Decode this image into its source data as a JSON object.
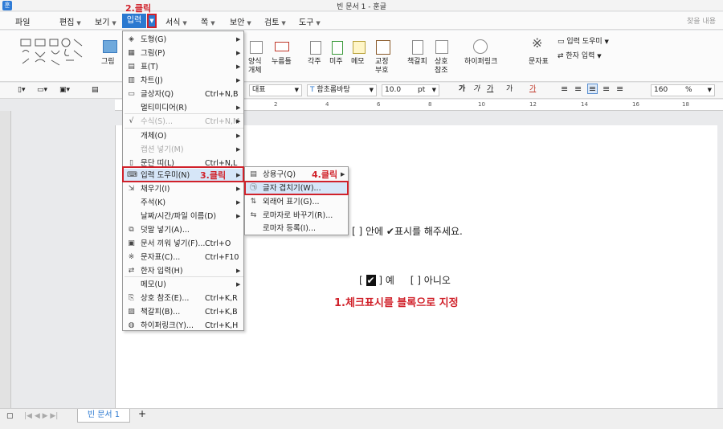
{
  "window": {
    "app_icon": "훈",
    "title": "빈 문서 1 - 훈글"
  },
  "menubar": {
    "items": [
      "파일",
      "편집",
      "보기",
      "입력",
      "서식",
      "쪽",
      "보안",
      "검토",
      "도구"
    ],
    "search_placeholder": "찾을 내용"
  },
  "ribbon": {
    "picture_label": "그림",
    "style_label": "양식\n개체",
    "button_label": "누름틀",
    "footnote_label": "각주",
    "endnote_label": "미주",
    "memo_label": "메모",
    "proof_label": "교정\n부호",
    "bookmark_label": "책갈피",
    "crossref_label": "상호\n참조",
    "hyperlink_label": "하이퍼링크",
    "charmap_label": "문자표",
    "input_helper_label": "입력 도우미",
    "hanja_label": "한자 입력"
  },
  "format": {
    "style": "대표",
    "font": "함초롬바탕",
    "size": "10.0",
    "size_unit": "pt",
    "zoom": "160",
    "zoom_unit": "%",
    "bold": "가",
    "italic": "가",
    "underline": "가",
    "strike": "가",
    "color": "가"
  },
  "ruler": {
    "ticks": [
      "2",
      "4",
      "6",
      "8",
      "10",
      "12",
      "14",
      "16",
      "18"
    ]
  },
  "document": {
    "line1": "[   ] 안에 ✔표시를 해주세요.",
    "line2_open": "[",
    "line2_check": "✔",
    "line2_close": "] 예",
    "line2_rest": "[    ] 아니오"
  },
  "annotations": {
    "step1": "1.체크표시를 블록으로 지정",
    "step2": "2.클릭",
    "step3": "3.클릭",
    "step4": "4.클릭"
  },
  "menu_main": [
    {
      "icon": "shape-icon",
      "glyph": "◈",
      "label": "도형(G)",
      "shortcut": "",
      "arrow": true,
      "disabled": false
    },
    {
      "icon": "picture-icon",
      "glyph": "▦",
      "label": "그림(P)",
      "shortcut": "",
      "arrow": true,
      "disabled": false
    },
    {
      "icon": "table-icon",
      "glyph": "▤",
      "label": "표(T)",
      "shortcut": "",
      "arrow": true,
      "disabled": false
    },
    {
      "icon": "chart-icon",
      "glyph": "▥",
      "label": "차트(J)",
      "shortcut": "",
      "arrow": true,
      "disabled": false
    },
    {
      "icon": "textbox-icon",
      "glyph": "▭",
      "label": "글상자(Q)",
      "shortcut": "Ctrl+N,B",
      "arrow": false,
      "disabled": false
    },
    {
      "icon": "",
      "glyph": "",
      "label": "멀티미디어(R)",
      "shortcut": "",
      "arrow": true,
      "disabled": false
    },
    {
      "icon": "formula-icon",
      "glyph": "√",
      "label": "수식(S)...",
      "shortcut": "Ctrl+N,M",
      "arrow": true,
      "disabled": true
    },
    {
      "icon": "",
      "glyph": "",
      "label": "개체(O)",
      "shortcut": "",
      "arrow": true,
      "disabled": false
    },
    {
      "icon": "",
      "glyph": "",
      "label": "캡션 넣기(M)",
      "shortcut": "",
      "arrow": true,
      "disabled": true
    },
    {
      "icon": "paragraph-break-icon",
      "glyph": "▯",
      "label": "문단 띠(L)",
      "shortcut": "Ctrl+N,L",
      "arrow": false,
      "disabled": false
    },
    {
      "icon": "input-helper-icon",
      "glyph": "⌨",
      "label": "입력 도우미(N)",
      "shortcut": "",
      "arrow": true,
      "disabled": false,
      "highlight": true
    },
    {
      "icon": "fill-icon",
      "glyph": "⇲",
      "label": "채우기(I)",
      "shortcut": "",
      "arrow": true,
      "disabled": false
    },
    {
      "icon": "",
      "glyph": "",
      "label": "주석(K)",
      "shortcut": "",
      "arrow": true,
      "disabled": false
    },
    {
      "icon": "",
      "glyph": "",
      "label": "날짜/시간/파일 이름(D)",
      "shortcut": "",
      "arrow": true,
      "disabled": false
    },
    {
      "icon": "overlay-icon",
      "glyph": "⧉",
      "label": "덧말 넣기(A)...",
      "shortcut": "",
      "arrow": false,
      "disabled": false
    },
    {
      "icon": "insert-doc-icon",
      "glyph": "▣",
      "label": "문서 끼워 넣기(F)...",
      "shortcut": "Ctrl+O",
      "arrow": false,
      "disabled": false
    },
    {
      "icon": "charmap-icon",
      "glyph": "※",
      "label": "문자표(C)...",
      "shortcut": "Ctrl+F10",
      "arrow": false,
      "disabled": false
    },
    {
      "icon": "hanja-icon",
      "glyph": "⇄",
      "label": "한자 입력(H)",
      "shortcut": "",
      "arrow": true,
      "disabled": false
    },
    {
      "icon": "",
      "glyph": "",
      "label": "메모(U)",
      "shortcut": "",
      "arrow": true,
      "disabled": false
    },
    {
      "icon": "crossref-icon",
      "glyph": "⎘",
      "label": "상호 참조(E)...",
      "shortcut": "Ctrl+K,R",
      "arrow": false,
      "disabled": false
    },
    {
      "icon": "bookmark-icon",
      "glyph": "▨",
      "label": "책갈피(B)...",
      "shortcut": "Ctrl+K,B",
      "arrow": false,
      "disabled": false
    },
    {
      "icon": "hyperlink-icon",
      "glyph": "◍",
      "label": "하이퍼링크(Y)...",
      "shortcut": "Ctrl+K,H",
      "arrow": false,
      "disabled": false
    }
  ],
  "menu_sub": [
    {
      "icon": "phrase-icon",
      "glyph": "▤",
      "label": "상용구(Q)",
      "arrow": true
    },
    {
      "icon": "char-overlap-icon",
      "glyph": "㉠",
      "label": "글자 겹치기(W)...",
      "arrow": false
    },
    {
      "icon": "foreign-icon",
      "glyph": "⇅",
      "label": "외래어 표기(G)...",
      "arrow": false
    },
    {
      "icon": "romanize-icon",
      "glyph": "⇆",
      "label": "로마자로 바꾸기(R)...",
      "arrow": false
    },
    {
      "icon": "",
      "glyph": "",
      "label": "로마자 등록(I)...",
      "arrow": false
    }
  ],
  "tabs": {
    "doc_tab": "빈 문서 1",
    "add": "+"
  }
}
